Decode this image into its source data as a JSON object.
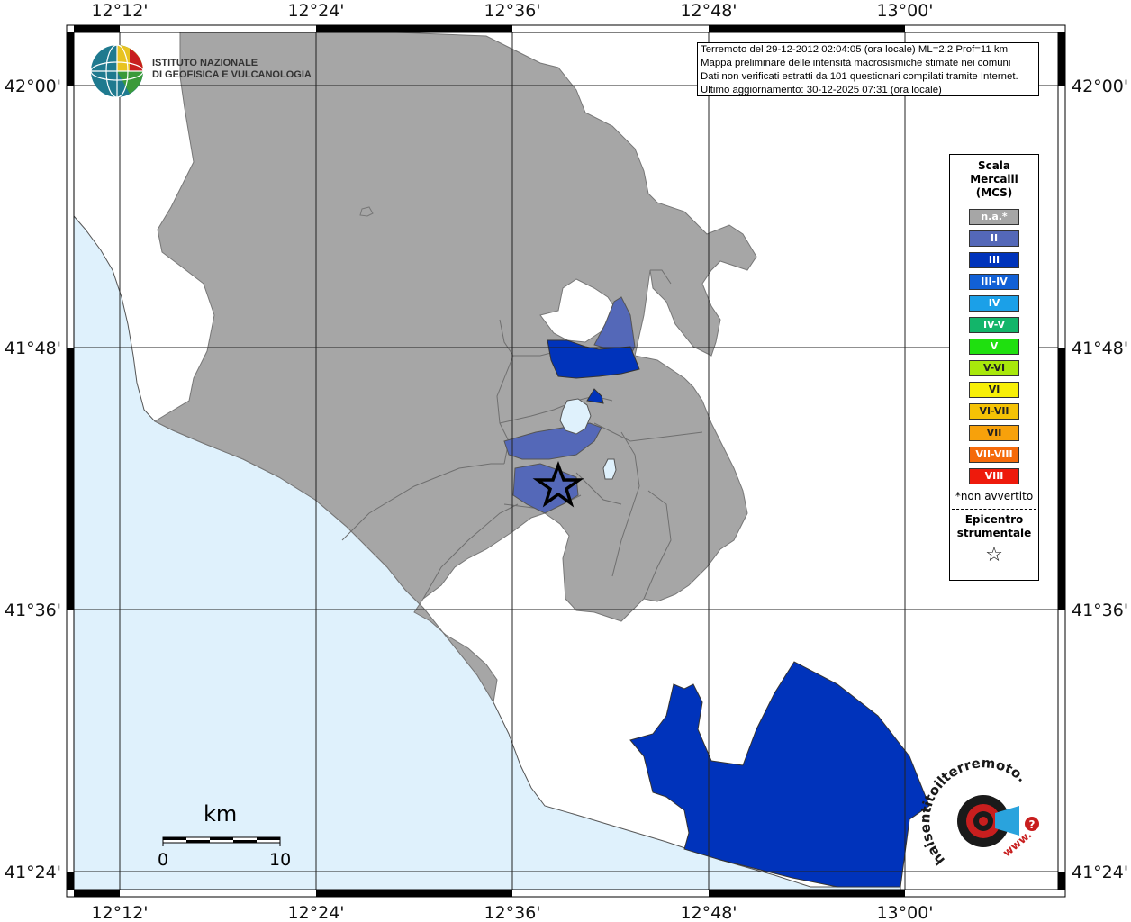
{
  "info": {
    "line1": "Terremoto del 29-12-2012 02:04:05 (ora locale) ML=2.2 Prof=11 km",
    "line2": "Mappa preliminare delle intensità macrosismiche stimate nei comuni",
    "line3": "Dati non verificati estratti da 101 questionari compilati tramite Internet.",
    "line4": "Ultimo aggiornamento: 30-12-2025 07:31 (ora locale)"
  },
  "institute": {
    "line1": "ISTITUTO NAZIONALE",
    "line2": "DI GEOFISICA E VULCANOLOGIA"
  },
  "axes": {
    "top_labels": [
      "12°12'",
      "12°24'",
      "12°36'",
      "12°48'",
      "13°00'"
    ],
    "bottom_labels": [
      "12°12'",
      "12°24'",
      "12°36'",
      "12°48'",
      "13°00'"
    ],
    "left_labels": [
      "42°00'",
      "41°48'",
      "41°36'",
      "41°24'"
    ],
    "right_labels": [
      "42°00'",
      "41°48'",
      "41°36'",
      "41°24'"
    ]
  },
  "legend": {
    "title_line1": "Scala",
    "title_line2": "Mercalli",
    "title_line3": "(MCS)",
    "items": [
      {
        "label": "n.a.*",
        "color": "#a6a6a6"
      },
      {
        "label": "II",
        "color": "#5468b8"
      },
      {
        "label": "III",
        "color": "#0033bb"
      },
      {
        "label": "III-IV",
        "color": "#1160d6"
      },
      {
        "label": "IV",
        "color": "#1ba0e8"
      },
      {
        "label": "IV-V",
        "color": "#13b56a"
      },
      {
        "label": "V",
        "color": "#1fe00f"
      },
      {
        "label": "V-VI",
        "color": "#a8e80b"
      },
      {
        "label": "VI",
        "color": "#f7ef06"
      },
      {
        "label": "VI-VII",
        "color": "#f5c205"
      },
      {
        "label": "VII",
        "color": "#f7a10b"
      },
      {
        "label": "VII-VIII",
        "color": "#f56a0a"
      },
      {
        "label": "VIII",
        "color": "#ee1a0c"
      }
    ],
    "note": "*non avvertito",
    "epicentre_line1": "Epicentro",
    "epicentre_line2": "strumentale",
    "epicentre_symbol": "☆"
  },
  "scalebar": {
    "unit": "km",
    "min": "0",
    "max": "10"
  },
  "website": {
    "text": "haisentitoilterremoto.it",
    "url": "www."
  },
  "colors": {
    "sea": "#dff1fc",
    "land": "#ffffff",
    "na": "#a6a6a6",
    "intensity_ii": "#5468b8",
    "intensity_iii": "#0033bb"
  }
}
